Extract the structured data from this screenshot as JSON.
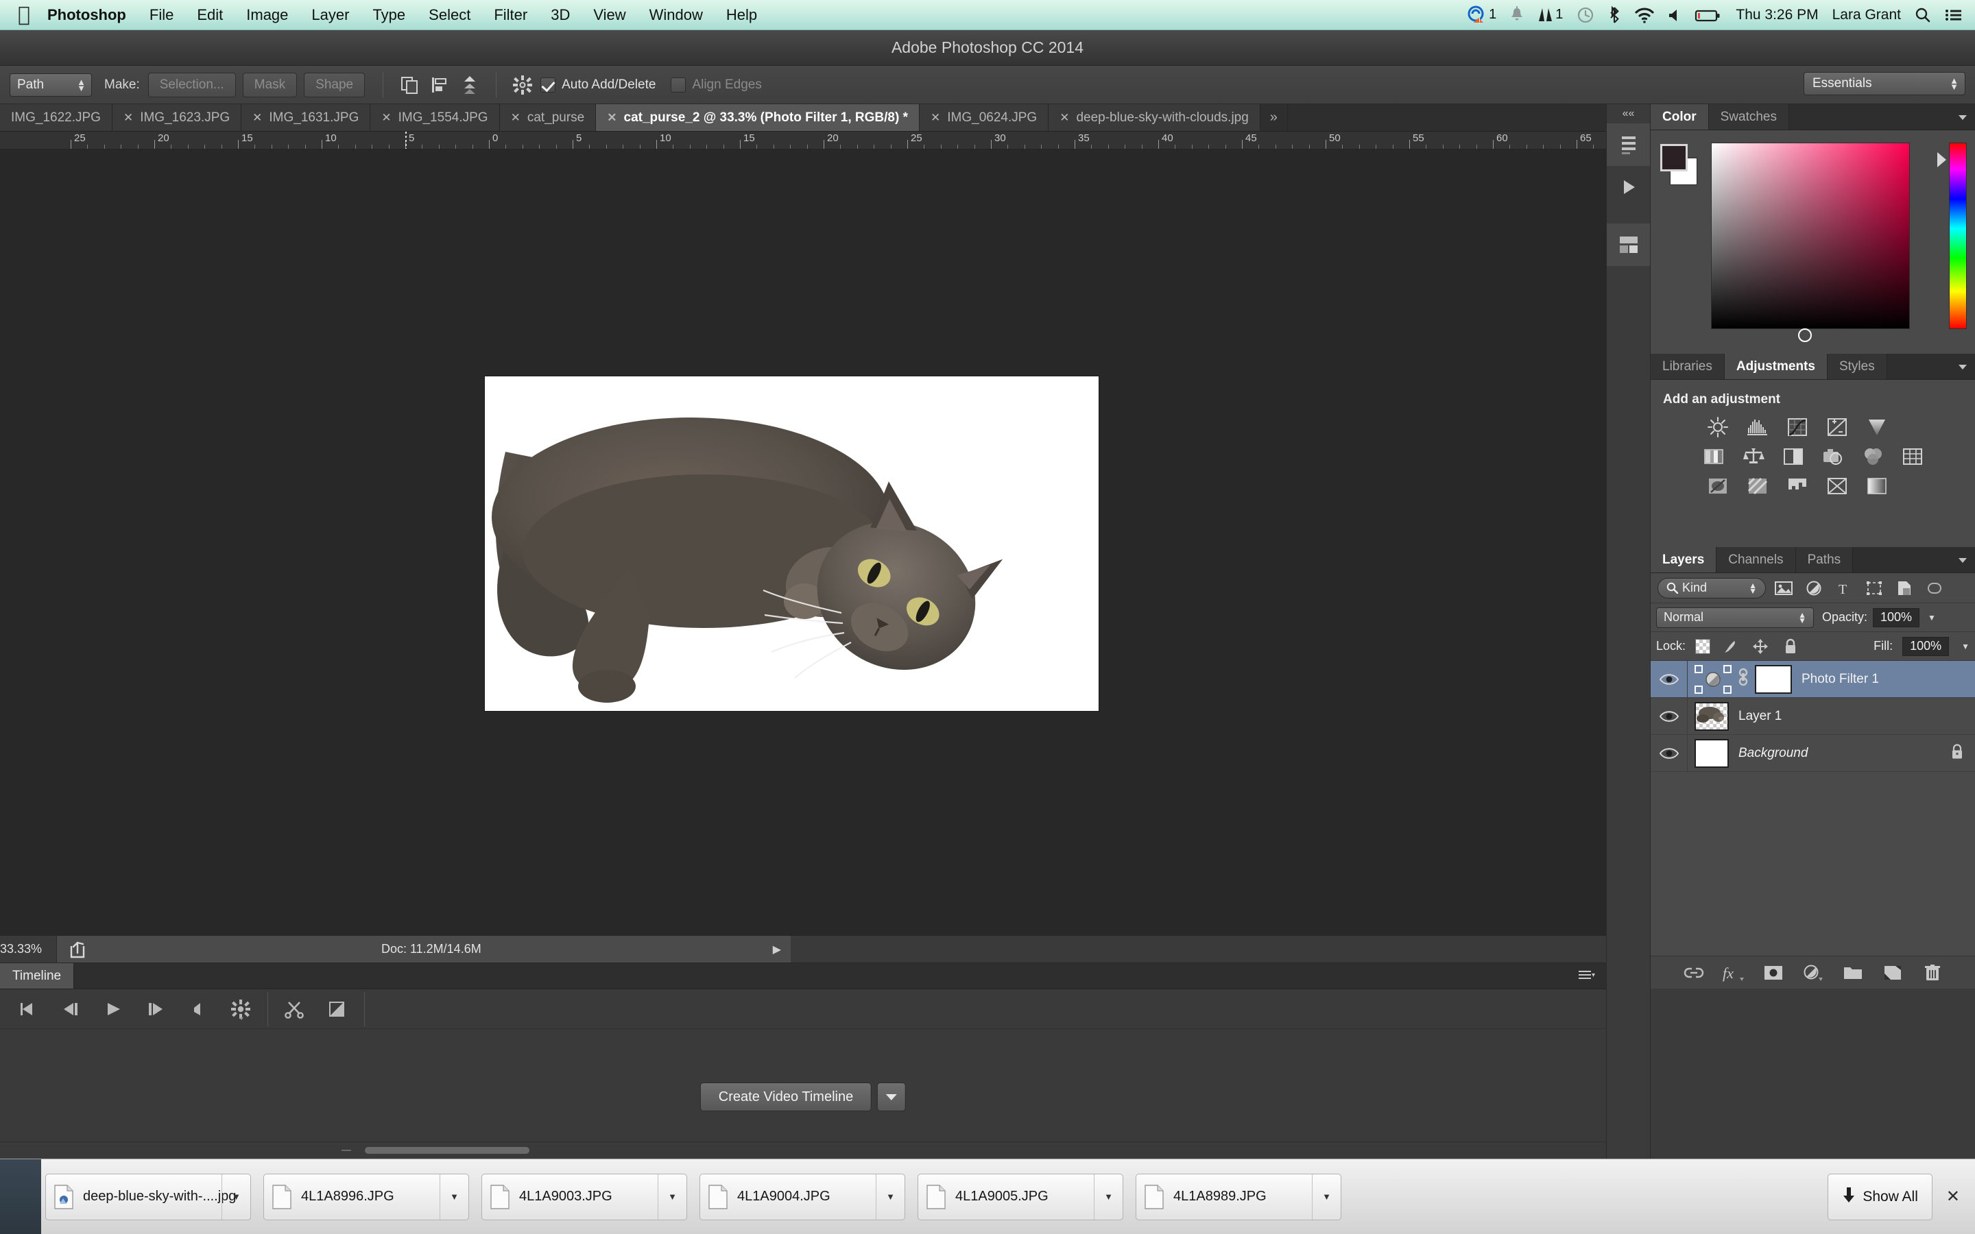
{
  "menubar": {
    "apple_icon": "apple-logo-icon",
    "app_name": "Photoshop",
    "items": [
      "File",
      "Edit",
      "Image",
      "Layer",
      "Type",
      "Select",
      "Filter",
      "3D",
      "View",
      "Window",
      "Help"
    ],
    "status": {
      "dropbox_badge": "1",
      "notification_icon": "bell-icon",
      "app_badge": "1",
      "clock_icon": "time-machine-icon",
      "bluetooth_icon": "bluetooth-icon",
      "wifi_icon": "wifi-icon",
      "volume_icon": "volume-icon",
      "battery_icon": "battery-icon",
      "datetime": "Thu 3:26 PM",
      "user": "Lara Grant",
      "search_icon": "search-icon",
      "notification_center_icon": "list-icon"
    }
  },
  "titlebar": {
    "title": "Adobe Photoshop CC 2014"
  },
  "options_bar": {
    "tool_mode": "Path",
    "make_label": "Make:",
    "buttons": [
      "Selection...",
      "Mask",
      "Shape"
    ],
    "path_op_icon": "path-operations-icon",
    "path_align_icon": "path-alignment-icon",
    "path_arrange_icon": "path-arrangement-icon",
    "gear_icon": "gear-icon",
    "auto_add_delete": {
      "label": "Auto Add/Delete",
      "checked": true
    },
    "align_edges": {
      "label": "Align Edges",
      "checked": false
    },
    "workspace": "Essentials"
  },
  "tabs": [
    {
      "label": "IMG_1622.JPG",
      "active": false,
      "closable": false
    },
    {
      "label": "IMG_1623.JPG",
      "active": false,
      "closable": true
    },
    {
      "label": "IMG_1631.JPG",
      "active": false,
      "closable": true
    },
    {
      "label": "IMG_1554.JPG",
      "active": false,
      "closable": true
    },
    {
      "label": "cat_purse",
      "active": false,
      "closable": true
    },
    {
      "label": "cat_purse_2 @ 33.3% (Photo Filter 1, RGB/8) *",
      "active": true,
      "closable": true
    },
    {
      "label": "IMG_0624.JPG",
      "active": false,
      "closable": true
    },
    {
      "label": "deep-blue-sky-with-clouds.jpg",
      "active": false,
      "closable": true
    }
  ],
  "tabs_overflow_icon": "chevron-double-right-icon",
  "ruler": {
    "labels": [
      "25",
      "20",
      "15",
      "10",
      "5",
      "0",
      "5",
      "10",
      "15",
      "20",
      "25",
      "30",
      "35",
      "40",
      "45",
      "50",
      "55",
      "60",
      "65"
    ],
    "unit": "cm"
  },
  "canvas": {
    "document_background": "#ffffff",
    "subject": "grey-cat-lying-down"
  },
  "status_bar": {
    "zoom": "33.33%",
    "share_icon": "share-icon",
    "doc_info": "Doc: 11.2M/14.6M",
    "expand_icon": "play-triangle-icon"
  },
  "timeline": {
    "tab_label": "Timeline",
    "panel_menu_icon": "panel-menu-icon",
    "controls": [
      "go-to-first-frame-icon",
      "previous-frame-icon",
      "play-icon",
      "next-frame-icon",
      "audio-icon",
      "render-icon"
    ],
    "edit_tools": [
      "split-at-playhead-icon",
      "transition-icon"
    ],
    "create_button": "Create Video Timeline",
    "create_caret_icon": "chevron-down-icon"
  },
  "color_panel": {
    "tabs": [
      "Color",
      "Swatches"
    ],
    "active_tab": "Color",
    "foreground": "#2b2023",
    "background": "#ffffff",
    "spectrum_hue": "#ff0050"
  },
  "adjustments_panel": {
    "tabs": [
      "Libraries",
      "Adjustments",
      "Styles"
    ],
    "active_tab": "Adjustments",
    "title": "Add an adjustment",
    "row1": [
      "brightness-contrast-icon",
      "levels-icon",
      "curves-icon",
      "exposure-icon",
      "vibrance-icon"
    ],
    "row2": [
      "hue-saturation-icon",
      "color-balance-icon",
      "black-white-icon",
      "photo-filter-icon",
      "channel-mixer-icon",
      "color-lookup-icon"
    ],
    "row3": [
      "invert-icon",
      "posterize-icon",
      "threshold-icon",
      "selective-color-icon",
      "gradient-map-icon"
    ]
  },
  "layers_panel": {
    "tabs": [
      "Layers",
      "Channels",
      "Paths"
    ],
    "active_tab": "Layers",
    "filter_kind": "Kind",
    "filter_icons": [
      "pixel-layers-filter-icon",
      "adjustment-layers-filter-icon",
      "type-layers-filter-icon",
      "shape-layers-filter-icon",
      "smart-object-filter-icon"
    ],
    "blend_mode": "Normal",
    "opacity_label": "Opacity:",
    "opacity_value": "100%",
    "lock_label": "Lock:",
    "lock_icons": [
      "lock-transparent-pixels-icon",
      "lock-image-pixels-icon",
      "lock-position-icon",
      "lock-all-icon"
    ],
    "fill_label": "Fill:",
    "fill_value": "100%",
    "layers": [
      {
        "name": "Photo Filter 1",
        "selected": true,
        "visible": true,
        "type": "adjustment",
        "locked": false,
        "italic": false
      },
      {
        "name": "Layer 1",
        "selected": false,
        "visible": true,
        "type": "pixel",
        "locked": false,
        "italic": false
      },
      {
        "name": "Background",
        "selected": false,
        "visible": true,
        "type": "background",
        "locked": true,
        "italic": true
      }
    ],
    "bottom_icons": [
      "link-layers-icon",
      "layer-style-fx-icon",
      "add-layer-mask-icon",
      "new-adjustment-layer-icon",
      "new-group-icon",
      "new-layer-icon",
      "delete-layer-icon"
    ]
  },
  "vertical_strip": {
    "collapse_icon": "collapse-panels-icon",
    "buttons": [
      "history-brush-icon",
      "play-action-icon",
      "properties-icon"
    ]
  },
  "download_bar": {
    "items": [
      {
        "name": "deep-blue-sky-with-....jpg",
        "icon": "image-file-icon"
      },
      {
        "name": "4L1A8996.JPG",
        "icon": "generic-file-icon"
      },
      {
        "name": "4L1A9003.JPG",
        "icon": "generic-file-icon"
      },
      {
        "name": "4L1A9004.JPG",
        "icon": "generic-file-icon"
      },
      {
        "name": "4L1A9005.JPG",
        "icon": "generic-file-icon"
      },
      {
        "name": "4L1A8989.JPG",
        "icon": "generic-file-icon"
      }
    ],
    "show_all_label": "Show All",
    "show_all_icon": "download-arrow-icon",
    "close_label": "✕"
  }
}
